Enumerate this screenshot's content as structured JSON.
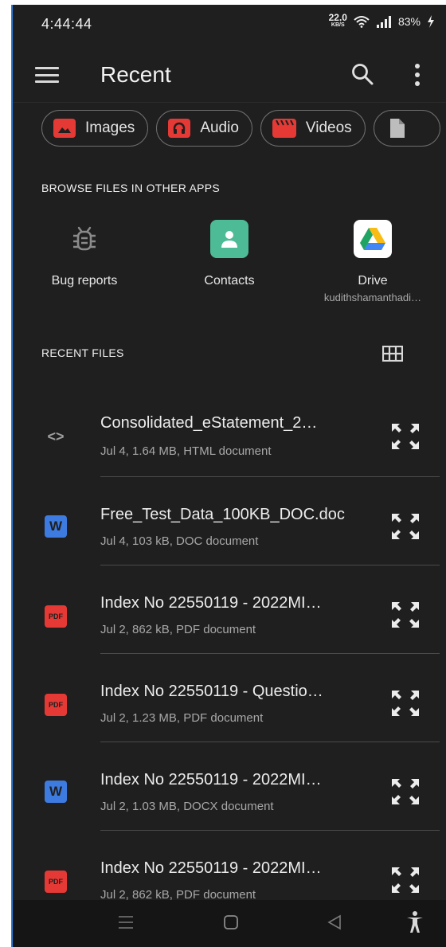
{
  "status_bar": {
    "time": "4:44:44",
    "net_speed_value": "22.0",
    "net_speed_unit": "KB/S",
    "battery": "83%"
  },
  "app_bar": {
    "title": "Recent",
    "menu_icon": "hamburger-menu-icon",
    "search_icon": "search-icon",
    "more_icon": "more-vertical-icon"
  },
  "chips": [
    {
      "label": "Images",
      "icon": "image-icon",
      "color": "#e53935"
    },
    {
      "label": "Audio",
      "icon": "headphones-icon",
      "color": "#e53935"
    },
    {
      "label": "Videos",
      "icon": "clapperboard-icon",
      "color": "#e53935"
    },
    {
      "label": "",
      "icon": "document-icon",
      "color": "#bdbdbd"
    }
  ],
  "browse_section": {
    "title": "BROWSE FILES IN OTHER APPS",
    "apps": [
      {
        "label": "Bug reports",
        "sub": "",
        "icon": "bug-icon"
      },
      {
        "label": "Contacts",
        "sub": "",
        "icon": "contacts-icon",
        "color": "#4dbb95"
      },
      {
        "label": "Drive",
        "sub": "kudithshamanthadi…",
        "icon": "google-drive-icon"
      }
    ]
  },
  "recent_section": {
    "title": "RECENT FILES",
    "view_icon": "grid-view-icon",
    "files": [
      {
        "name": "Consolidated_eStatement_2…",
        "meta": "Jul 4, 1.64 MB, HTML document",
        "type": "html",
        "icon_text": "<>"
      },
      {
        "name": "Free_Test_Data_100KB_DOC.doc",
        "meta": "Jul 4, 103 kB, DOC document",
        "type": "word",
        "icon_text": "W"
      },
      {
        "name": "Index No 22550119 - 2022MI…",
        "meta": "Jul 2, 862 kB, PDF document",
        "type": "pdf",
        "icon_text": "PDF"
      },
      {
        "name": "Index No 22550119 - Questio…",
        "meta": "Jul 2, 1.23 MB, PDF document",
        "type": "pdf",
        "icon_text": "PDF"
      },
      {
        "name": "Index No 22550119 - 2022MI…",
        "meta": "Jul 2, 1.03 MB, DOCX document",
        "type": "word",
        "icon_text": "W"
      },
      {
        "name": "Index No 22550119 - 2022MI…",
        "meta": "Jul 2, 862 kB, PDF document",
        "type": "pdf",
        "icon_text": "PDF"
      }
    ]
  },
  "nav_bar": {
    "recents_icon": "recents-icon",
    "home_icon": "home-icon",
    "back_icon": "back-icon",
    "accessibility_icon": "accessibility-icon"
  },
  "colors": {
    "background": "#1f1f1f",
    "pdf": "#e53935",
    "word": "#3d7be0",
    "contacts": "#4dbb95"
  }
}
